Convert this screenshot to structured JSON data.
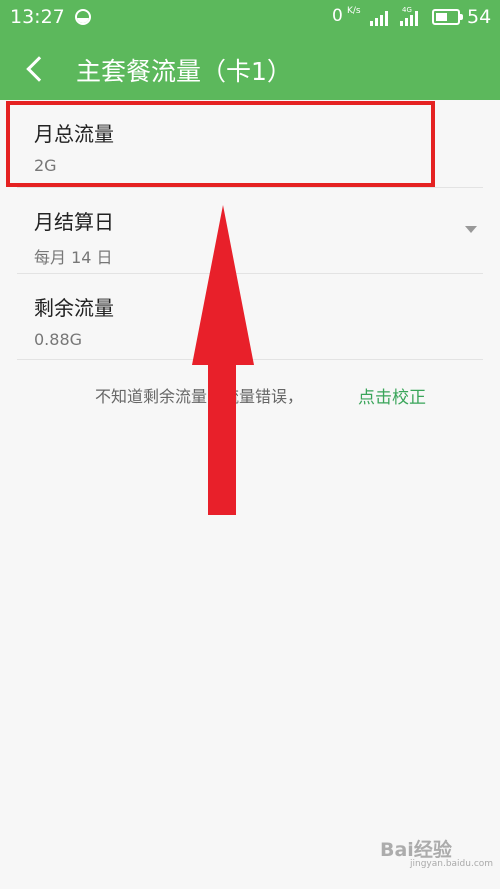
{
  "status_bar": {
    "time": "13:27",
    "net_speed_value": "0",
    "net_speed_unit": "K/s",
    "network_type": "4G",
    "battery_level": 54,
    "battery_text": "54"
  },
  "header": {
    "title": "主套餐流量（卡1）"
  },
  "settings": {
    "monthly_total": {
      "label": "月总流量",
      "value": "2G"
    },
    "billing_day": {
      "label": "月结算日",
      "value": "每月 14 日"
    },
    "remaining": {
      "label": "剩余流量",
      "value": "0.88G"
    }
  },
  "hint": {
    "text": "不知道剩余流量或流量错误，",
    "link": "点击校正"
  },
  "watermark": {
    "brand": "Bai经验",
    "url": "jingyan.baidu.com"
  },
  "colors": {
    "header_bg": "#5cb85c",
    "highlight": "#e52222",
    "link": "#3aa55a"
  }
}
